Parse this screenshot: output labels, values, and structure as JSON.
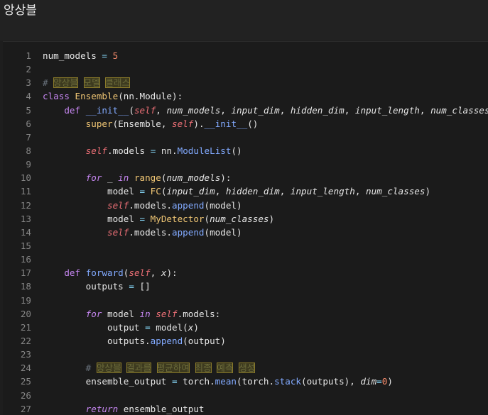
{
  "title": "앙상블",
  "lines": [
    {
      "n": "1",
      "tokens": [
        [
          "t",
          "num_models "
        ],
        [
          "op",
          "="
        ],
        [
          "t",
          " "
        ],
        [
          "num",
          "5"
        ]
      ]
    },
    {
      "n": "2",
      "tokens": []
    },
    {
      "n": "3",
      "tokens": [
        [
          "cm",
          "# "
        ],
        [
          "hl",
          "앙상블"
        ],
        [
          "cm",
          " "
        ],
        [
          "hl",
          "모델"
        ],
        [
          "cm",
          " "
        ],
        [
          "hl",
          "클래스"
        ]
      ]
    },
    {
      "n": "4",
      "tokens": [
        [
          "kw",
          "class"
        ],
        [
          "t",
          " "
        ],
        [
          "cls",
          "Ensemble"
        ],
        [
          "t",
          "(nn.Module):"
        ]
      ]
    },
    {
      "n": "5",
      "tokens": [
        [
          "t",
          "    "
        ],
        [
          "kw",
          "def"
        ],
        [
          "t",
          " "
        ],
        [
          "meth",
          "__init__"
        ],
        [
          "t",
          "("
        ],
        [
          "self",
          "self"
        ],
        [
          "t",
          ", "
        ],
        [
          "param",
          "num_models"
        ],
        [
          "t",
          ", "
        ],
        [
          "param",
          "input_dim"
        ],
        [
          "t",
          ", "
        ],
        [
          "param",
          "hidden_dim"
        ],
        [
          "t",
          ", "
        ],
        [
          "param",
          "input_length"
        ],
        [
          "t",
          ", "
        ],
        [
          "param",
          "num_classes"
        ],
        [
          "t",
          "):"
        ]
      ]
    },
    {
      "n": "6",
      "tokens": [
        [
          "t",
          "        "
        ],
        [
          "fn",
          "super"
        ],
        [
          "t",
          "("
        ],
        [
          "t",
          "Ensemble, "
        ],
        [
          "self",
          "self"
        ],
        [
          "t",
          ")."
        ],
        [
          "meth",
          "__init__"
        ],
        [
          "t",
          "()"
        ]
      ]
    },
    {
      "n": "7",
      "tokens": []
    },
    {
      "n": "8",
      "tokens": [
        [
          "t",
          "        "
        ],
        [
          "self",
          "self"
        ],
        [
          "t",
          ".models "
        ],
        [
          "op",
          "="
        ],
        [
          "t",
          " nn."
        ],
        [
          "meth",
          "ModuleList"
        ],
        [
          "t",
          "()"
        ]
      ]
    },
    {
      "n": "9",
      "tokens": []
    },
    {
      "n": "10",
      "tokens": [
        [
          "t",
          "        "
        ],
        [
          "kwi",
          "for"
        ],
        [
          "t",
          " _ "
        ],
        [
          "kwi",
          "in"
        ],
        [
          "t",
          " "
        ],
        [
          "fn",
          "range"
        ],
        [
          "t",
          "("
        ],
        [
          "param",
          "num_models"
        ],
        [
          "t",
          "):"
        ]
      ]
    },
    {
      "n": "11",
      "tokens": [
        [
          "t",
          "            model "
        ],
        [
          "op",
          "="
        ],
        [
          "t",
          " "
        ],
        [
          "fn",
          "FC"
        ],
        [
          "t",
          "("
        ],
        [
          "param",
          "input_dim"
        ],
        [
          "t",
          ", "
        ],
        [
          "param",
          "hidden_dim"
        ],
        [
          "t",
          ", "
        ],
        [
          "param",
          "input_length"
        ],
        [
          "t",
          ", "
        ],
        [
          "param",
          "num_classes"
        ],
        [
          "t",
          ")"
        ]
      ]
    },
    {
      "n": "12",
      "tokens": [
        [
          "t",
          "            "
        ],
        [
          "self",
          "self"
        ],
        [
          "t",
          ".models."
        ],
        [
          "meth",
          "append"
        ],
        [
          "t",
          "(model)"
        ]
      ]
    },
    {
      "n": "13",
      "tokens": [
        [
          "t",
          "            model "
        ],
        [
          "op",
          "="
        ],
        [
          "t",
          " "
        ],
        [
          "fn",
          "MyDetector"
        ],
        [
          "t",
          "("
        ],
        [
          "param",
          "num_classes"
        ],
        [
          "t",
          ")"
        ]
      ]
    },
    {
      "n": "14",
      "tokens": [
        [
          "t",
          "            "
        ],
        [
          "self",
          "self"
        ],
        [
          "t",
          ".models."
        ],
        [
          "meth",
          "append"
        ],
        [
          "t",
          "(model)"
        ]
      ]
    },
    {
      "n": "15",
      "tokens": []
    },
    {
      "n": "16",
      "tokens": []
    },
    {
      "n": "17",
      "tokens": [
        [
          "t",
          "    "
        ],
        [
          "kw",
          "def"
        ],
        [
          "t",
          " "
        ],
        [
          "meth",
          "forward"
        ],
        [
          "t",
          "("
        ],
        [
          "self",
          "self"
        ],
        [
          "t",
          ", "
        ],
        [
          "param",
          "x"
        ],
        [
          "t",
          "):"
        ]
      ]
    },
    {
      "n": "18",
      "tokens": [
        [
          "t",
          "        outputs "
        ],
        [
          "op",
          "="
        ],
        [
          "t",
          " []"
        ]
      ]
    },
    {
      "n": "19",
      "tokens": []
    },
    {
      "n": "20",
      "tokens": [
        [
          "t",
          "        "
        ],
        [
          "kwi",
          "for"
        ],
        [
          "t",
          " model "
        ],
        [
          "kwi",
          "in"
        ],
        [
          "t",
          " "
        ],
        [
          "self",
          "self"
        ],
        [
          "t",
          ".models:"
        ]
      ]
    },
    {
      "n": "21",
      "tokens": [
        [
          "t",
          "            output "
        ],
        [
          "op",
          "="
        ],
        [
          "t",
          " model("
        ],
        [
          "param",
          "x"
        ],
        [
          "t",
          ")"
        ]
      ]
    },
    {
      "n": "22",
      "tokens": [
        [
          "t",
          "            outputs."
        ],
        [
          "meth",
          "append"
        ],
        [
          "t",
          "(output)"
        ]
      ]
    },
    {
      "n": "23",
      "tokens": []
    },
    {
      "n": "24",
      "tokens": [
        [
          "t",
          "        "
        ],
        [
          "cm",
          "# "
        ],
        [
          "hl",
          "앙상블"
        ],
        [
          "cm",
          " "
        ],
        [
          "hl",
          "결과를"
        ],
        [
          "cm",
          " "
        ],
        [
          "hl",
          "평균하여"
        ],
        [
          "cm",
          " "
        ],
        [
          "hl",
          "최종"
        ],
        [
          "cm",
          " "
        ],
        [
          "hl",
          "예측"
        ],
        [
          "cm",
          " "
        ],
        [
          "hl",
          "생성"
        ]
      ]
    },
    {
      "n": "25",
      "tokens": [
        [
          "t",
          "        ensemble_output "
        ],
        [
          "op",
          "="
        ],
        [
          "t",
          " torch."
        ],
        [
          "meth",
          "mean"
        ],
        [
          "t",
          "(torch."
        ],
        [
          "meth",
          "stack"
        ],
        [
          "t",
          "(outputs), "
        ],
        [
          "param",
          "dim"
        ],
        [
          "op",
          "="
        ],
        [
          "num",
          "0"
        ],
        [
          "t",
          ")"
        ]
      ]
    },
    {
      "n": "26",
      "tokens": []
    },
    {
      "n": "27",
      "tokens": [
        [
          "t",
          "        "
        ],
        [
          "kwi",
          "return"
        ],
        [
          "t",
          " ensemble_output"
        ]
      ]
    }
  ],
  "colors": {
    "background": "#1b1b1b",
    "keyword": "#c586f0",
    "class": "#f0c674",
    "self": "#f07178",
    "number": "#f78c6c",
    "method": "#82aaff",
    "comment": "#6a737d",
    "line_number": "#858585"
  }
}
